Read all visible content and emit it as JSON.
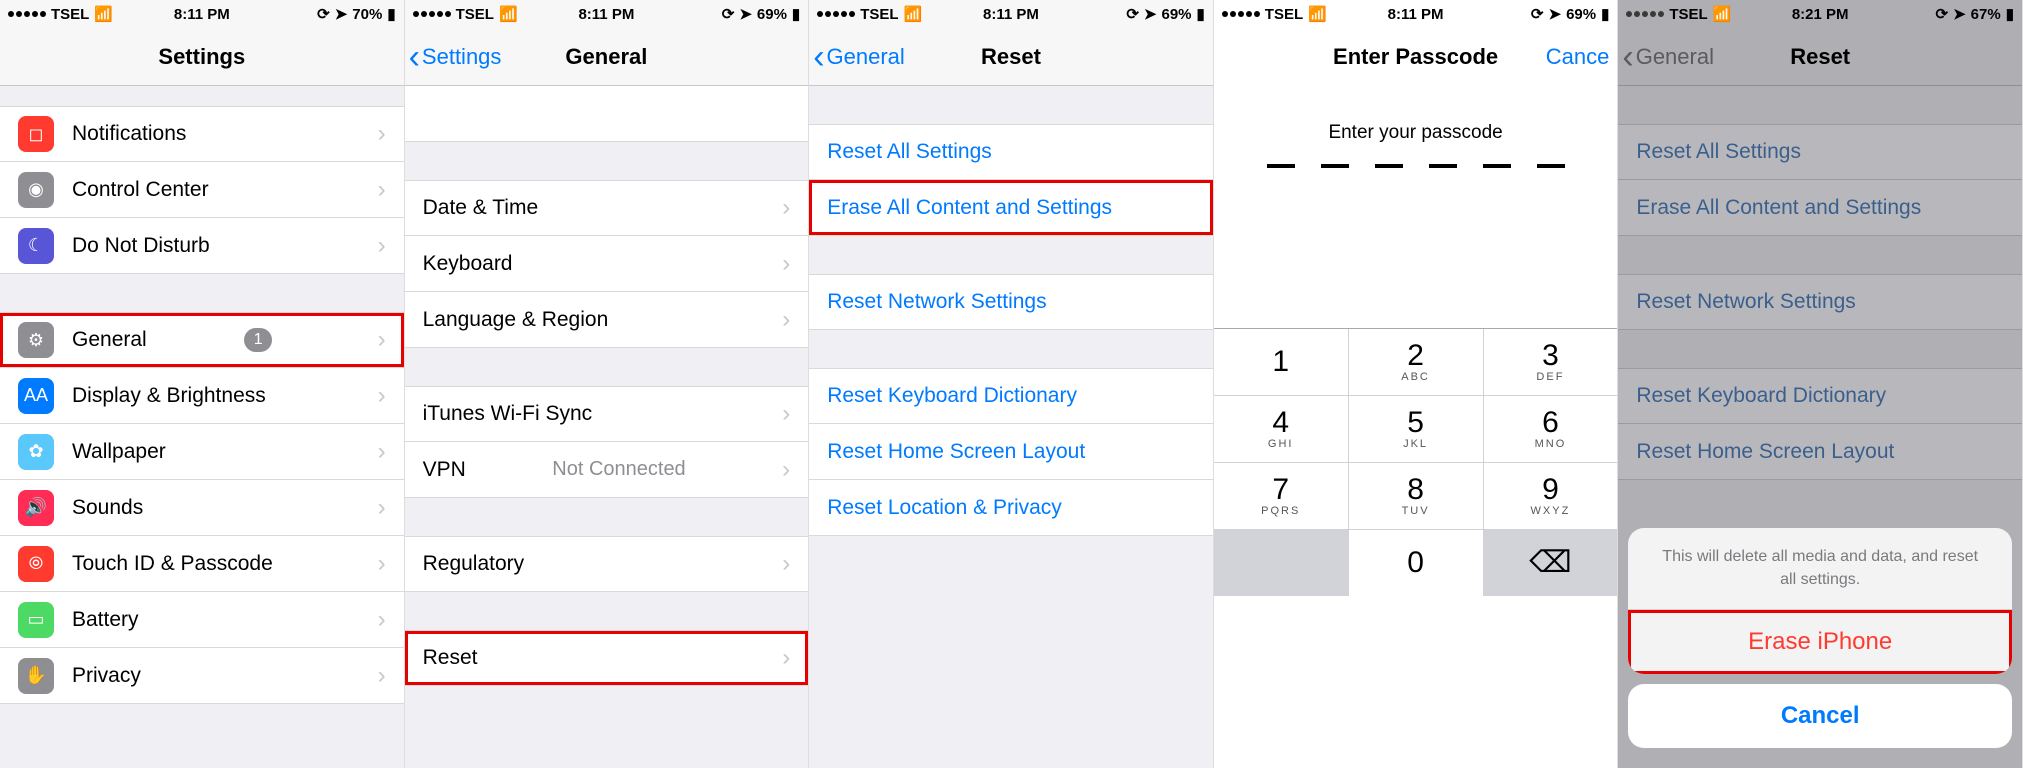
{
  "s1": {
    "status": {
      "carrier": "TSEL",
      "time": "8:11 PM",
      "battery": "70%"
    },
    "title": "Settings",
    "items": [
      {
        "label": "Notifications",
        "color": "#ff3b30",
        "glyph": "◻︎"
      },
      {
        "label": "Control Center",
        "color": "#8e8e93",
        "glyph": "◉"
      },
      {
        "label": "Do Not Disturb",
        "color": "#5856d6",
        "glyph": "☾"
      }
    ],
    "items2": [
      {
        "label": "General",
        "color": "#8e8e93",
        "glyph": "⚙︎",
        "badge": "1"
      },
      {
        "label": "Display & Brightness",
        "color": "#007aff",
        "glyph": "AA"
      },
      {
        "label": "Wallpaper",
        "color": "#5ac8fa",
        "glyph": "✿"
      },
      {
        "label": "Sounds",
        "color": "#ff2d55",
        "glyph": "🔊"
      },
      {
        "label": "Touch ID & Passcode",
        "color": "#ff3b30",
        "glyph": "⦾"
      },
      {
        "label": "Battery",
        "color": "#4cd964",
        "glyph": "▭"
      },
      {
        "label": "Privacy",
        "color": "#8e8e93",
        "glyph": "✋"
      }
    ]
  },
  "s2": {
    "status": {
      "carrier": "TSEL",
      "time": "8:11 PM",
      "battery": "69%"
    },
    "back": "Settings",
    "title": "General",
    "group1": [
      "Date & Time",
      "Keyboard",
      "Language & Region"
    ],
    "group2": [
      {
        "label": "iTunes Wi-Fi Sync",
        "detail": ""
      },
      {
        "label": "VPN",
        "detail": "Not Connected"
      }
    ],
    "group3": [
      "Regulatory"
    ],
    "group4": [
      "Reset"
    ]
  },
  "s3": {
    "status": {
      "carrier": "TSEL",
      "time": "8:11 PM",
      "battery": "69%"
    },
    "back": "General",
    "title": "Reset",
    "g1": [
      "Reset All Settings",
      "Erase All Content and Settings"
    ],
    "g2": [
      "Reset Network Settings"
    ],
    "g3": [
      "Reset Keyboard Dictionary",
      "Reset Home Screen Layout",
      "Reset Location & Privacy"
    ]
  },
  "s4": {
    "status": {
      "carrier": "TSEL",
      "time": "8:11 PM",
      "battery": "69%"
    },
    "title": "Enter Passcode",
    "cancel": "Cance",
    "prompt": "Enter your passcode",
    "keys": [
      {
        "n": "1",
        "l": ""
      },
      {
        "n": "2",
        "l": "ABC"
      },
      {
        "n": "3",
        "l": "DEF"
      },
      {
        "n": "4",
        "l": "GHI"
      },
      {
        "n": "5",
        "l": "JKL"
      },
      {
        "n": "6",
        "l": "MNO"
      },
      {
        "n": "7",
        "l": "PQRS"
      },
      {
        "n": "8",
        "l": "TUV"
      },
      {
        "n": "9",
        "l": "WXYZ"
      },
      {
        "n": "",
        "l": "",
        "gray": true
      },
      {
        "n": "0",
        "l": ""
      },
      {
        "n": "⌫",
        "l": "",
        "gray": true
      }
    ]
  },
  "s5": {
    "status": {
      "carrier": "TSEL",
      "time": "8:21 PM",
      "battery": "67%"
    },
    "back": "General",
    "title": "Reset",
    "g1": [
      "Reset All Settings",
      "Erase All Content and Settings"
    ],
    "g2": [
      "Reset Network Settings"
    ],
    "g3": [
      "Reset Keyboard Dictionary",
      "Reset Home Screen Layout"
    ],
    "sheet": {
      "msg": "This will delete all media and data, and reset all settings.",
      "erase": "Erase iPhone",
      "cancel": "Cancel"
    }
  },
  "icons": {
    "wifi": "📶",
    "nav": "➤",
    "lock": "⟳"
  }
}
